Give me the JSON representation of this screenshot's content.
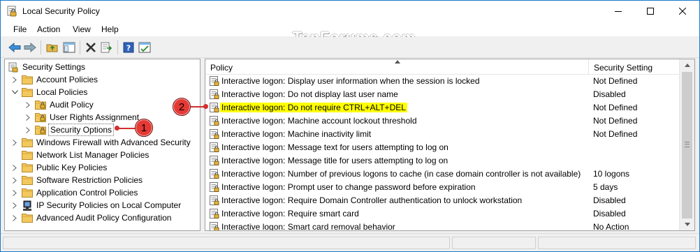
{
  "window": {
    "title": "Local Security Policy",
    "controls": [
      "minimize",
      "maximize",
      "close"
    ]
  },
  "menu": [
    "File",
    "Action",
    "View",
    "Help"
  ],
  "toolbar": {
    "buttons": [
      "back-icon",
      "forward-icon",
      "up-folder-icon",
      "show-hide-tree-icon",
      "delete-icon",
      "export-list-icon",
      "help-icon",
      "properties-icon"
    ]
  },
  "watermark": "TenForums.com",
  "tree": {
    "root": "Security Settings",
    "items": [
      {
        "label": "Account Policies",
        "level": 1,
        "expanded": false
      },
      {
        "label": "Local Policies",
        "level": 1,
        "expanded": true
      },
      {
        "label": "Audit Policy",
        "level": 2,
        "expanded": false
      },
      {
        "label": "User Rights Assignment",
        "level": 2,
        "expanded": false
      },
      {
        "label": "Security Options",
        "level": 2,
        "expanded": false,
        "selected": true
      },
      {
        "label": "Windows Firewall with Advanced Security",
        "level": 1,
        "expanded": false
      },
      {
        "label": "Network List Manager Policies",
        "level": 1,
        "leaf": true
      },
      {
        "label": "Public Key Policies",
        "level": 1,
        "expanded": false
      },
      {
        "label": "Software Restriction Policies",
        "level": 1,
        "expanded": false
      },
      {
        "label": "Application Control Policies",
        "level": 1,
        "expanded": false
      },
      {
        "label": "IP Security Policies on Local Computer",
        "level": 1,
        "expanded": false
      },
      {
        "label": "Advanced Audit Policy Configuration",
        "level": 1,
        "expanded": false
      }
    ]
  },
  "list": {
    "columns": {
      "policy": "Policy",
      "setting": "Security Setting"
    },
    "rows": [
      {
        "policy": "Interactive logon: Display user information when the session is locked",
        "setting": "Not Defined"
      },
      {
        "policy": "Interactive logon: Do not display last user name",
        "setting": "Disabled"
      },
      {
        "policy": "Interactive logon: Do not require CTRL+ALT+DEL",
        "setting": "Not Defined",
        "highlighted": true
      },
      {
        "policy": "Interactive logon: Machine account lockout threshold",
        "setting": "Not Defined"
      },
      {
        "policy": "Interactive logon: Machine inactivity limit",
        "setting": "Not Defined"
      },
      {
        "policy": "Interactive logon: Message text for users attempting to log on",
        "setting": ""
      },
      {
        "policy": "Interactive logon: Message title for users attempting to log on",
        "setting": ""
      },
      {
        "policy": "Interactive logon: Number of previous logons to cache (in case domain controller is not available)",
        "setting": "10 logons"
      },
      {
        "policy": "Interactive logon: Prompt user to change password before expiration",
        "setting": "5 days"
      },
      {
        "policy": "Interactive logon: Require Domain Controller authentication to unlock workstation",
        "setting": "Disabled"
      },
      {
        "policy": "Interactive logon: Require smart card",
        "setting": "Disabled"
      },
      {
        "policy": "Interactive logon: Smart card removal behavior",
        "setting": "No Action"
      }
    ]
  },
  "callouts": [
    {
      "number": "1",
      "target": "Security Options"
    },
    {
      "number": "2",
      "target": "Interactive logon: Do not require CTRL+ALT+DEL"
    }
  ],
  "colors": {
    "highlight": "#ffff00",
    "callout": "#e53935",
    "folder": "#e8b64c",
    "window_border": "#1979ca"
  }
}
